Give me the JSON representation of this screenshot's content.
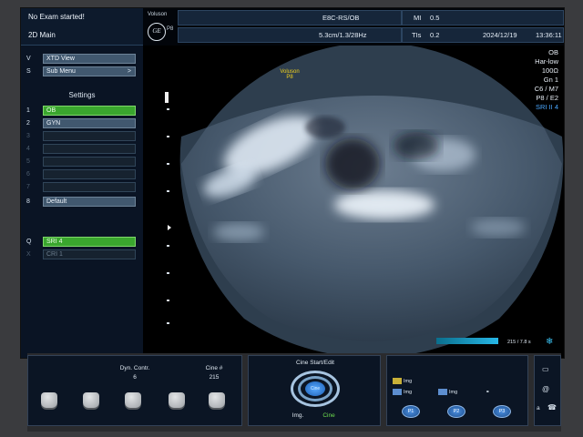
{
  "header": {
    "exam_status": "No Exam started!",
    "mode": "2D Main",
    "brand": "Voluson",
    "probe_model": "P8",
    "ge_logo": "GE",
    "probe": "E8C-RS/OB",
    "mi": "MI",
    "mi_value": "0.5",
    "depth_info": "5.3cm/1.3/28Hz",
    "tis": "TIs",
    "tis_value": "0.2",
    "date": "2024/12/19",
    "time": "13:36:11"
  },
  "left_panel": {
    "menu": [
      {
        "key": "V",
        "label": "XTD View"
      },
      {
        "key": "S",
        "label": "Sub Menu",
        "arrow": ">"
      }
    ],
    "settings_title": "Settings",
    "presets": [
      {
        "key": "1",
        "label": "OB",
        "state": "active"
      },
      {
        "key": "2",
        "label": "GYN",
        "state": "normal"
      },
      {
        "key": "3",
        "label": "",
        "state": "empty"
      },
      {
        "key": "4",
        "label": "",
        "state": "empty"
      },
      {
        "key": "5",
        "label": "",
        "state": "empty"
      },
      {
        "key": "6",
        "label": "",
        "state": "empty"
      },
      {
        "key": "7",
        "label": "",
        "state": "empty"
      },
      {
        "key": "8",
        "label": "Default",
        "state": "normal"
      }
    ],
    "sri": {
      "key": "Q",
      "label": "SRI 4"
    },
    "cri": {
      "key": "X",
      "label": "CRI 1"
    }
  },
  "image_area": {
    "overlay_brand": "Voluson",
    "overlay_probe": "P8",
    "params": [
      "OB",
      "Har-low",
      "100Ω",
      "Gn   1",
      "C6 / M7",
      "P8 / E2",
      "SRI II 4"
    ],
    "cine_counter": "215 / 7.8 s",
    "freeze_icon": "snowflake-icon"
  },
  "console": {
    "dyn_contr_label": "Dyn. Contr.",
    "dyn_contr_value": "6",
    "cine_label": "Cine #",
    "cine_value": "215",
    "cine_start_label": "Cine Start/Edit",
    "dial_center": "Cine",
    "img_label": "Img.",
    "cine_label2": "Cine",
    "img_items": [
      "Img",
      "Img",
      "Img"
    ],
    "p_buttons": [
      "P1",
      "P2",
      "P3"
    ],
    "p3_icon": "link-icon",
    "side_icons": [
      "monitor-icon",
      "at-icon",
      "phone-icon"
    ],
    "side_label_a": "a"
  },
  "colors": {
    "accent_green": "#3aa62e",
    "overlay_yellow": "#f2d21e",
    "sri_blue": "#4aa7ff"
  }
}
